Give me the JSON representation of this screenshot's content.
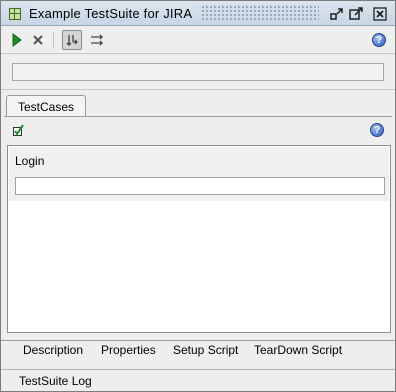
{
  "window": {
    "title": "Example TestSuite for JIRA",
    "title_icon": "testsuite-grid-icon",
    "controls": [
      "detach-icon",
      "maximize-icon",
      "close-icon"
    ]
  },
  "toolbar": {
    "run_icon": "play-icon",
    "cancel_icon": "cancel-x-icon",
    "sequential_icon": "sequential-mode-icon",
    "parallel_icon": "parallel-mode-icon",
    "help_label": "?"
  },
  "progress": {
    "value": ""
  },
  "tabs": [
    {
      "label": "TestCases"
    }
  ],
  "testcases_toolbar": {
    "add_icon": "add-testcase-icon",
    "help_label": "?"
  },
  "testcases": [
    {
      "name": "Login",
      "progress_value": ""
    }
  ],
  "bottom_tabs": [
    {
      "label": "Description"
    },
    {
      "label": "Properties"
    },
    {
      "label": "Setup Script"
    },
    {
      "label": "TearDown Script"
    }
  ],
  "log": {
    "label": "TestSuite Log"
  },
  "colors": {
    "titlebar": "#c8d6e6",
    "run_green": "#1f8a2c",
    "help_blue": "#2d5bb5"
  }
}
